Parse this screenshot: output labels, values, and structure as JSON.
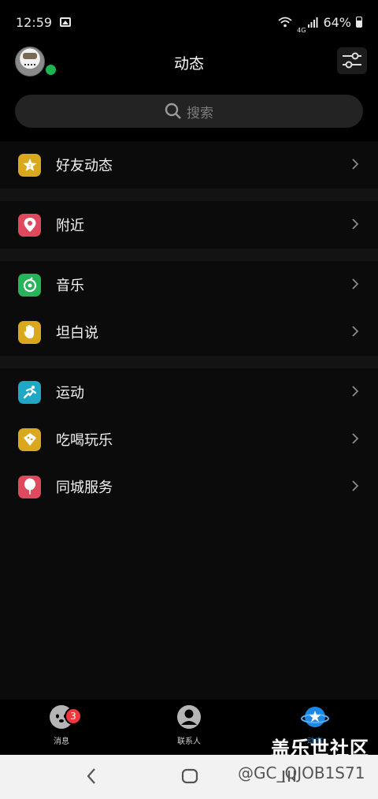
{
  "status_bar": {
    "time": "12:59",
    "network": "4G",
    "battery": "64%"
  },
  "header": {
    "title": "动态"
  },
  "search": {
    "placeholder": "搜索"
  },
  "menu": {
    "sections": [
      {
        "items": [
          {
            "label": "好友动态",
            "icon": "friends-star-icon",
            "color": "#d9a81c"
          }
        ]
      },
      {
        "items": [
          {
            "label": "附近",
            "icon": "location-pin-icon",
            "color": "#e0485e"
          }
        ]
      },
      {
        "items": [
          {
            "label": "音乐",
            "icon": "music-disc-icon",
            "color": "#27b35a"
          },
          {
            "label": "坦白说",
            "icon": "hand-icon",
            "color": "#d9a81c"
          }
        ]
      },
      {
        "items": [
          {
            "label": "运动",
            "icon": "running-icon",
            "color": "#1fa7c6"
          },
          {
            "label": "吃喝玩乐",
            "icon": "food-icon",
            "color": "#d9a81c"
          },
          {
            "label": "同城服务",
            "icon": "balloon-icon",
            "color": "#e0485e"
          }
        ]
      }
    ]
  },
  "tab_bar": {
    "messages": {
      "label": "消息",
      "badge": "3"
    },
    "contacts": {
      "label": "联系人"
    },
    "dynamics": {
      "label": "动态",
      "active_color": "#1e88e5"
    }
  },
  "watermark": {
    "brand": "盖乐世社区",
    "handle": "@GC_QJOB1S71"
  }
}
